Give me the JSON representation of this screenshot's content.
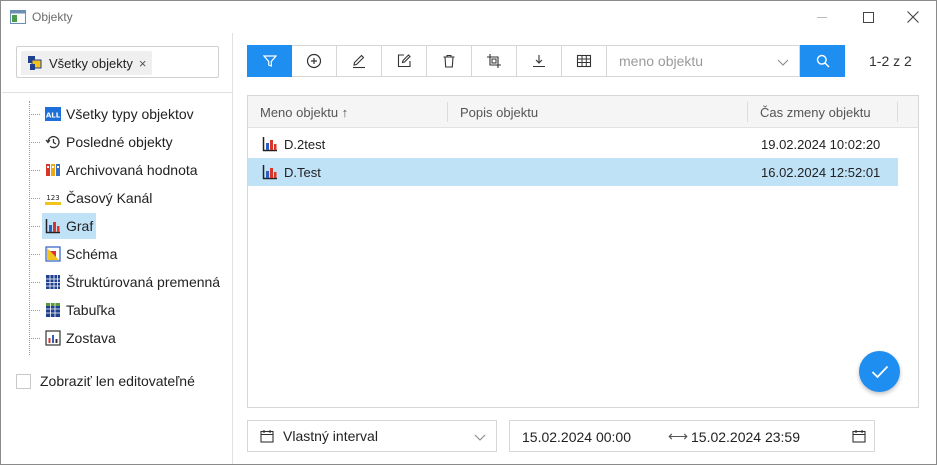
{
  "window": {
    "title": "Objekty"
  },
  "filter": {
    "chip_label": "Všetky objekty"
  },
  "tree": {
    "items": [
      {
        "label": "Všetky typy objektov",
        "icon": "all-types-icon"
      },
      {
        "label": "Posledné objekty",
        "icon": "history-icon"
      },
      {
        "label": "Archivovaná hodnota",
        "icon": "archive-value-icon"
      },
      {
        "label": "Časový Kanál",
        "icon": "time-channel-icon"
      },
      {
        "label": "Graf",
        "icon": "graph-icon",
        "selected": true
      },
      {
        "label": "Schéma",
        "icon": "scheme-icon"
      },
      {
        "label": "Štruktúrovaná premenná",
        "icon": "structured-variable-icon"
      },
      {
        "label": "Tabuľka",
        "icon": "table-icon"
      },
      {
        "label": "Zostava",
        "icon": "report-icon"
      }
    ]
  },
  "editable_only": {
    "label": "Zobraziť len editovateľné",
    "checked": false
  },
  "toolbar": {
    "buttons": [
      "filter-icon",
      "add-icon",
      "edit-icon",
      "edit-doc-icon",
      "delete-icon",
      "crop-icon",
      "download-icon",
      "grid-icon"
    ],
    "search_placeholder": "meno objektu",
    "result_count": "1-2 z 2"
  },
  "table": {
    "columns": [
      "Meno objektu ↑",
      "Popis objektu",
      "Čas zmeny objektu"
    ],
    "rows": [
      {
        "name": "D.2test",
        "description": "",
        "changed": "19.02.2024 10:02:20",
        "selected": false
      },
      {
        "name": "D.Test",
        "description": "",
        "changed": "16.02.2024 12:52:01",
        "selected": true
      }
    ]
  },
  "interval": {
    "label": "Vlastný interval",
    "from": "15.02.2024 00:00",
    "to": "15.02.2024 23:59"
  },
  "colors": {
    "accent": "#1e8ef0",
    "selection": "#bfe2f7"
  }
}
